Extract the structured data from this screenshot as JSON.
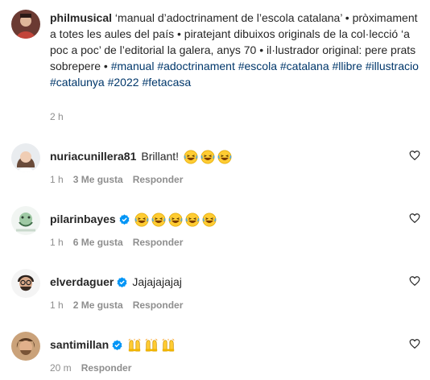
{
  "caption": {
    "username": "philmusical",
    "text": "‘manual d’adoctrinament de l’escola catalana’ • pròximament a totes les aules del país • piratejant dibuixos originals de la col·lecció ‘a poc a poc’ de l’editorial la galera, anys 70 • il·lustrador original: pere prats sobrepere •",
    "hashtags": [
      "#manual",
      "#adoctrinament",
      "#escola",
      "#catalana",
      "#llibre",
      "#illustracio",
      "#catalunya",
      "#2022",
      "#fetacasa"
    ],
    "time": "2 h"
  },
  "comments": [
    {
      "username": "nuriacunillera81",
      "verified": false,
      "text": "Brillant!",
      "emoji_count": 3,
      "emoji": "laughing-emoji",
      "time": "1 h",
      "likes": "3 Me gusta",
      "reply": "Responder"
    },
    {
      "username": "pilarinbayes",
      "verified": true,
      "text": "",
      "emoji_count": 5,
      "emoji": "laughing-emoji",
      "time": "1 h",
      "likes": "6 Me gusta",
      "reply": "Responder"
    },
    {
      "username": "elverdaguer",
      "verified": true,
      "text": "Jajajajajaj",
      "emoji_count": 0,
      "emoji": "",
      "time": "1 h",
      "likes": "2 Me gusta",
      "reply": "Responder"
    },
    {
      "username": "santimillan",
      "verified": true,
      "text": "",
      "emoji_count": 3,
      "emoji": "raised-hands-emoji",
      "time": "20 m",
      "likes": "",
      "reply": "Responder"
    }
  ],
  "colors": {
    "text": "#262626",
    "muted": "#8e8e8e",
    "link": "#00376b",
    "verified": "#0095f6"
  },
  "icons": {
    "like": "heart-icon",
    "verified": "verified-badge-icon"
  }
}
